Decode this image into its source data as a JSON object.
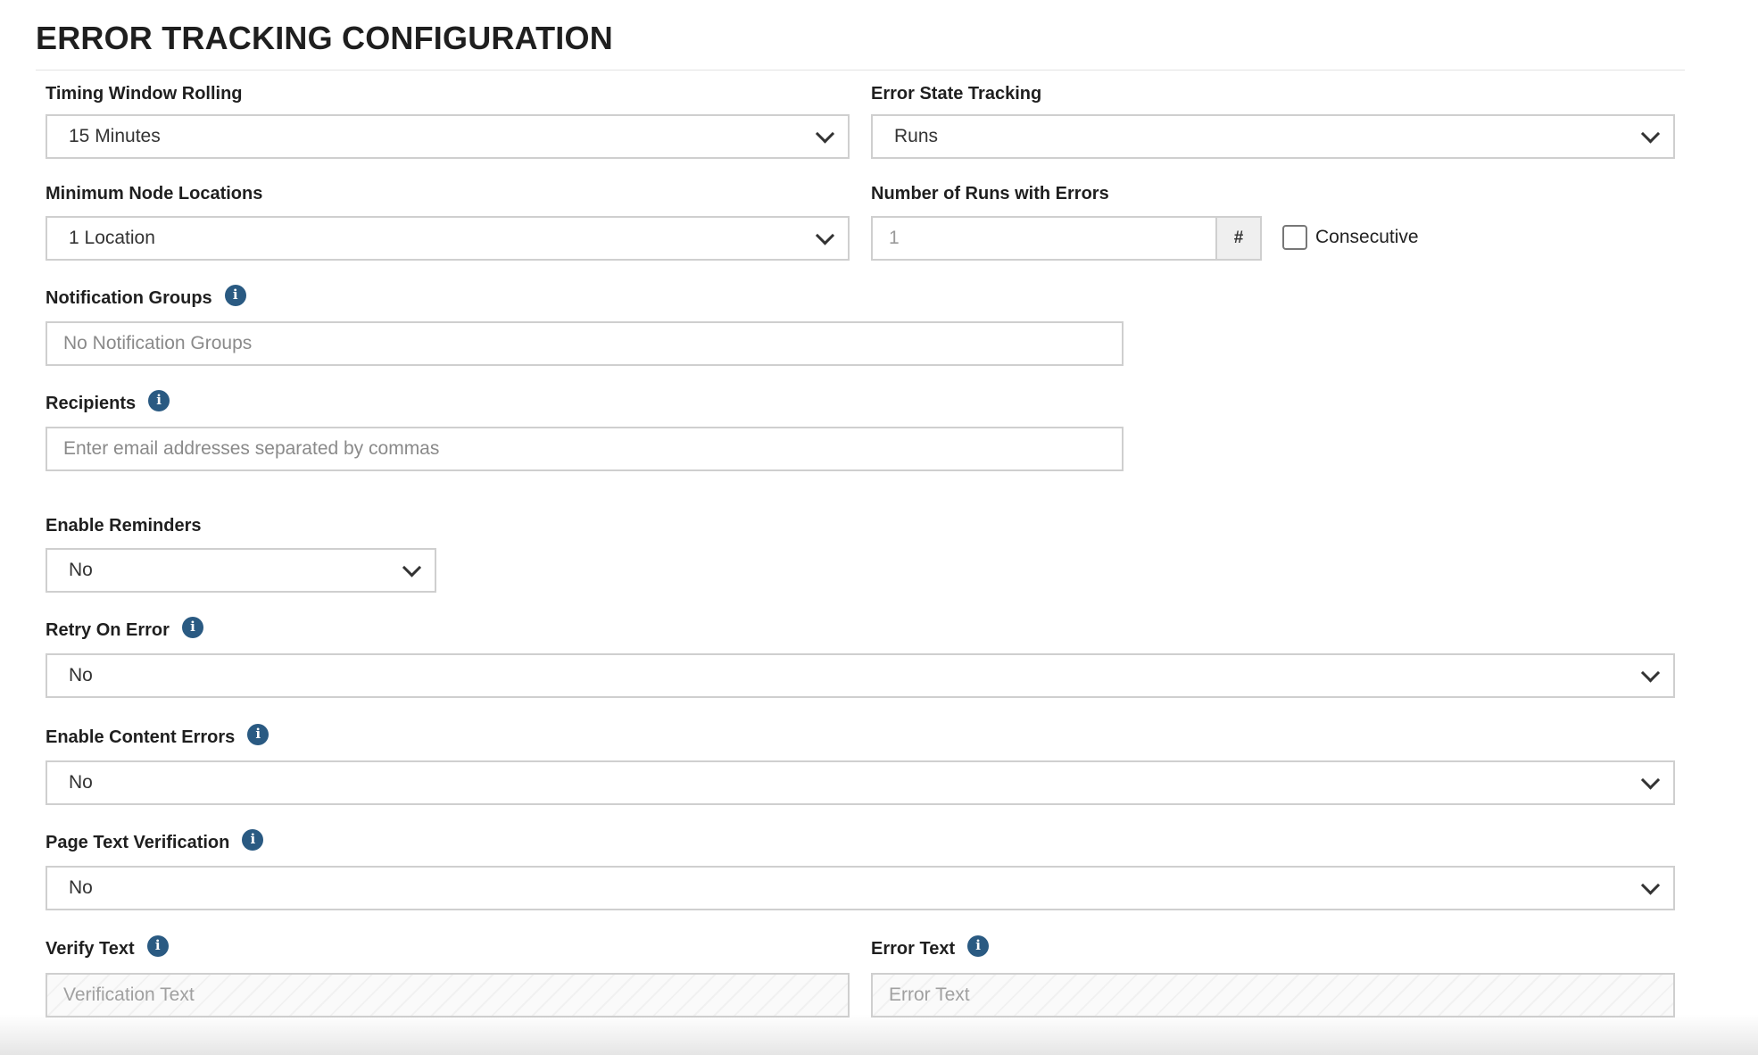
{
  "section": {
    "title": "ERROR TRACKING CONFIGURATION"
  },
  "timing_window": {
    "label": "Timing Window Rolling",
    "value": "15 Minutes"
  },
  "error_state": {
    "label": "Error State Tracking",
    "value": "Runs"
  },
  "min_nodes": {
    "label": "Minimum Node Locations",
    "value": "1 Location"
  },
  "runs_with_errors": {
    "label": "Number of Runs with Errors",
    "value": "1",
    "addon": "#",
    "consecutive_label": "Consecutive",
    "consecutive_checked": false
  },
  "notification_groups": {
    "label": "Notification Groups",
    "placeholder": "No Notification Groups"
  },
  "recipients": {
    "label": "Recipients",
    "placeholder": "Enter email addresses separated by commas"
  },
  "reminders": {
    "label": "Enable Reminders",
    "value": "No"
  },
  "retry": {
    "label": "Retry On Error",
    "value": "No"
  },
  "content_errors": {
    "label": "Enable Content Errors",
    "value": "No"
  },
  "page_text": {
    "label": "Page Text Verification",
    "value": "No"
  },
  "verify_text": {
    "label": "Verify Text",
    "placeholder": "Verification Text"
  },
  "error_text": {
    "label": "Error Text",
    "placeholder": "Error Text"
  },
  "icons": {
    "info": "info-icon",
    "dropdown": "chevron-down-icon"
  },
  "colors": {
    "info_icon": "#2a5a82",
    "border": "#cfcfcf"
  }
}
